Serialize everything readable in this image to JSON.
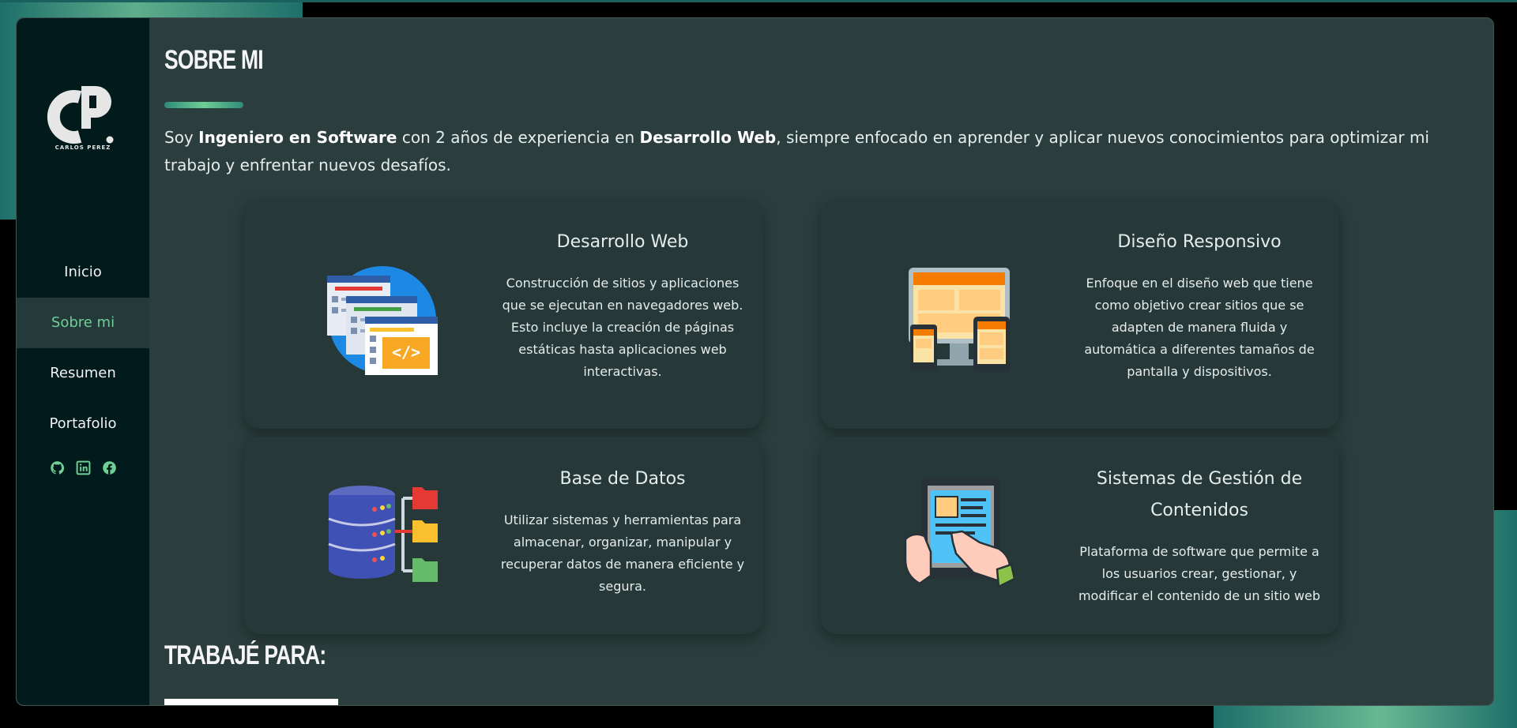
{
  "brand": {
    "name": "CARLOS PEREZ",
    "monogram": "CP"
  },
  "nav": {
    "items": [
      {
        "label": "Inicio",
        "active": false
      },
      {
        "label": "Sobre mi",
        "active": true
      },
      {
        "label": "Resumen",
        "active": false
      },
      {
        "label": "Portafolio",
        "active": false
      }
    ],
    "socials": [
      "github-icon",
      "linkedin-icon",
      "facebook-icon"
    ]
  },
  "about": {
    "title": "SOBRE MI",
    "intro_1": "Soy ",
    "intro_strong_1": "Ingeniero en Software",
    "intro_2": " con 2 años de experiencia en ",
    "intro_strong_2": "Desarrollo Web",
    "intro_3": ", siempre enfocado en aprender y aplicar nuevos conocimientos para optimizar mi trabajo y enfrentar nuevos desafíos."
  },
  "services": [
    {
      "title": "Desarrollo Web",
      "description": "Construcción de sitios y aplicaciones que se ejecutan en navegadores web. Esto incluye la creación de páginas estáticas hasta aplicaciones web interactivas.",
      "icon": "web-development-icon"
    },
    {
      "title": "Diseño Responsivo",
      "description": "Enfoque en el diseño web que tiene como objetivo crear sitios que se adapten de manera fluida y automática a diferentes tamaños de pantalla y dispositivos.",
      "icon": "responsive-design-icon"
    },
    {
      "title": "Base de Datos",
      "description": "Utilizar sistemas y herramientas para almacenar, organizar, manipular y recuperar datos de manera eficiente y segura.",
      "icon": "database-icon"
    },
    {
      "title": "Sistemas de Gestión de Contenidos",
      "description": "Plataforma de software que permite a los usuarios crear, gestionar, y modificar el contenido de un sitio web",
      "icon": "cms-icon"
    }
  ],
  "worked_for": {
    "title": "TRABAJÉ PARA:"
  },
  "colors": {
    "accent": "#6fcf97",
    "sidebar": "#011a1b",
    "panel": "#2b3e3d",
    "card": "#263838"
  }
}
